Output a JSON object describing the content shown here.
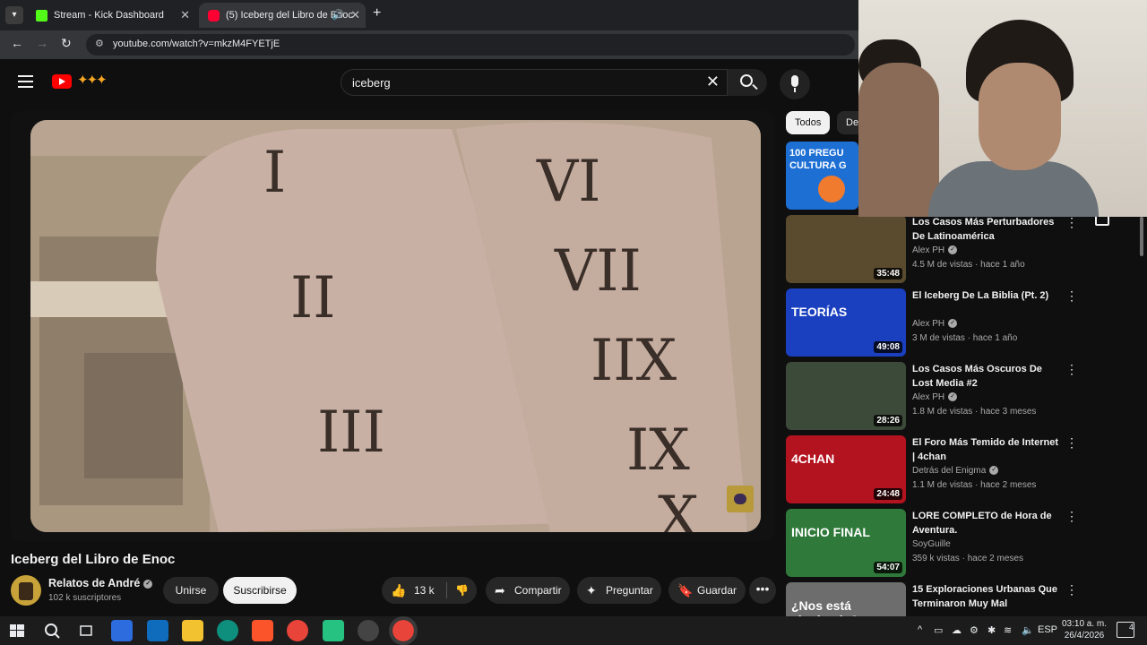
{
  "browser": {
    "tabs": [
      {
        "label": "Stream - Kick Dashboard",
        "favicon_color": "#53fc18"
      },
      {
        "label": "(5) Iceberg del Libro de Enoc",
        "favicon_color": "#ff0033",
        "active": true
      }
    ],
    "url_host": "youtube.com",
    "url_path": "/watch?v=mkzM4FYETjE"
  },
  "youtube": {
    "search_query": "iceberg"
  },
  "video": {
    "title": "Iceberg del Libro de Enoc",
    "channel": "Relatos de André",
    "subscribers": "102 k suscriptores",
    "join_label": "Unirse",
    "subscribe_label": "Suscribirse",
    "likes": "13 k",
    "share_label": "Compartir",
    "ask_label": "Preguntar",
    "save_label": "Guardar",
    "numerals": [
      "I",
      "II",
      "III",
      "VI",
      "VII",
      "IIX",
      "IX",
      "X"
    ]
  },
  "sidebar": {
    "chips": [
      "Todos",
      "De"
    ],
    "top_thumb_text": "100 PREGU CULTURA G",
    "recommendations": [
      {
        "title": "Los Casos Más Perturbadores De Latinoamérica",
        "channel": "Alex PH",
        "verified": true,
        "meta": "4.5 M de vistas · hace 1 año",
        "duration": "35:48",
        "color": "#5a4a2e",
        "thumb_text": ""
      },
      {
        "title": "El Iceberg De La Biblia (Pt. 2)",
        "channel": "Alex PH",
        "verified": true,
        "meta": "3 M de vistas · hace 1 año",
        "duration": "49:08",
        "color": "#1a3fbf",
        "thumb_text": "TEORÍAS"
      },
      {
        "title": "Los Casos Más Oscuros De Lost Media #2",
        "channel": "Alex PH",
        "verified": true,
        "meta": "1.8 M de vistas · hace 3 meses",
        "duration": "28:26",
        "color": "#3c4a3a",
        "thumb_text": ""
      },
      {
        "title": "El Foro Más Temido de Internet | 4chan",
        "channel": "Detrás del Enigma",
        "verified": true,
        "meta": "1.1 M de vistas · hace 2 meses",
        "duration": "24:48",
        "color": "#b3121f",
        "thumb_text": "4CHAN"
      },
      {
        "title": "LORE COMPLETO de Hora de Aventura.",
        "channel": "SoyGuille",
        "verified": false,
        "meta": "359 k vistas · hace 2 meses",
        "duration": "54:07",
        "color": "#2f7a3a",
        "thumb_text": "INICIO FINAL"
      },
      {
        "title": "15 Exploraciones Urbanas Que Terminaron Muy Mal",
        "channel": "",
        "verified": false,
        "meta": "",
        "duration": "",
        "color": "#6d6d6d",
        "thumb_text": "¿Nos está siguiendo?"
      }
    ]
  },
  "taskbar": {
    "language": "ESP",
    "time": "03:10 a. m.",
    "date": "26/4/2026",
    "notifications": "4"
  }
}
